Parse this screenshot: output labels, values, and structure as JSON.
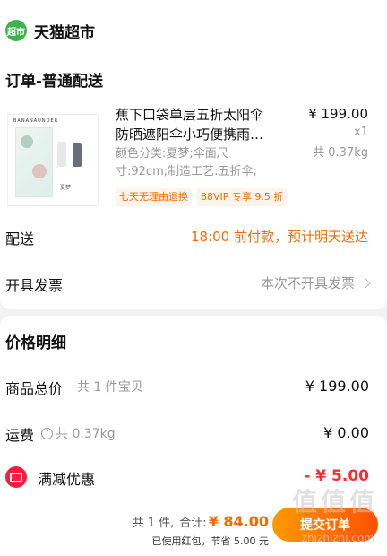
{
  "store": {
    "logo_text": "超市",
    "name": "天猫超市"
  },
  "order": {
    "type": "订单-普通配送"
  },
  "product": {
    "brand": "BANANAUNDER",
    "thumb_caption": "夏梦",
    "title_line1": "蕉下口袋单层五折太阳伞",
    "title_line2": "防晒遮阳伞小巧便携雨…",
    "spec_line1": "颜色分类:夏梦;伞面尺",
    "spec_line2": "寸:92cm;制造工艺:五折伞;",
    "price": "¥ 199.00",
    "qty": "x1",
    "weight": "共 0.37kg",
    "tags": [
      "七天无理由退换",
      "88VIP 专享 9.5 折"
    ]
  },
  "delivery": {
    "label": "配送",
    "value": "18:00 前付款，预计明天送达"
  },
  "invoice": {
    "label": "开具发票",
    "value": "本次不开具发票"
  },
  "price_detail": {
    "title": "价格明细",
    "goods_label": "商品总价",
    "goods_sub": "共 1 件宝贝",
    "goods_value": "¥ 199.00",
    "ship_label": "运费",
    "ship_sub": "共 0.37kg",
    "ship_value": "¥ 0.00",
    "promo_label": "满减优惠",
    "promo_value": "- ¥ 5.00"
  },
  "footer": {
    "count": "共 1 件,",
    "total_label": "合计:",
    "total_value": "¥ 84.00",
    "saved": "已使用红包，节省 5.00 元",
    "submit": "提交订单"
  },
  "watermark": {
    "main": "值值值",
    "sub": "zhizhizhi.com"
  }
}
